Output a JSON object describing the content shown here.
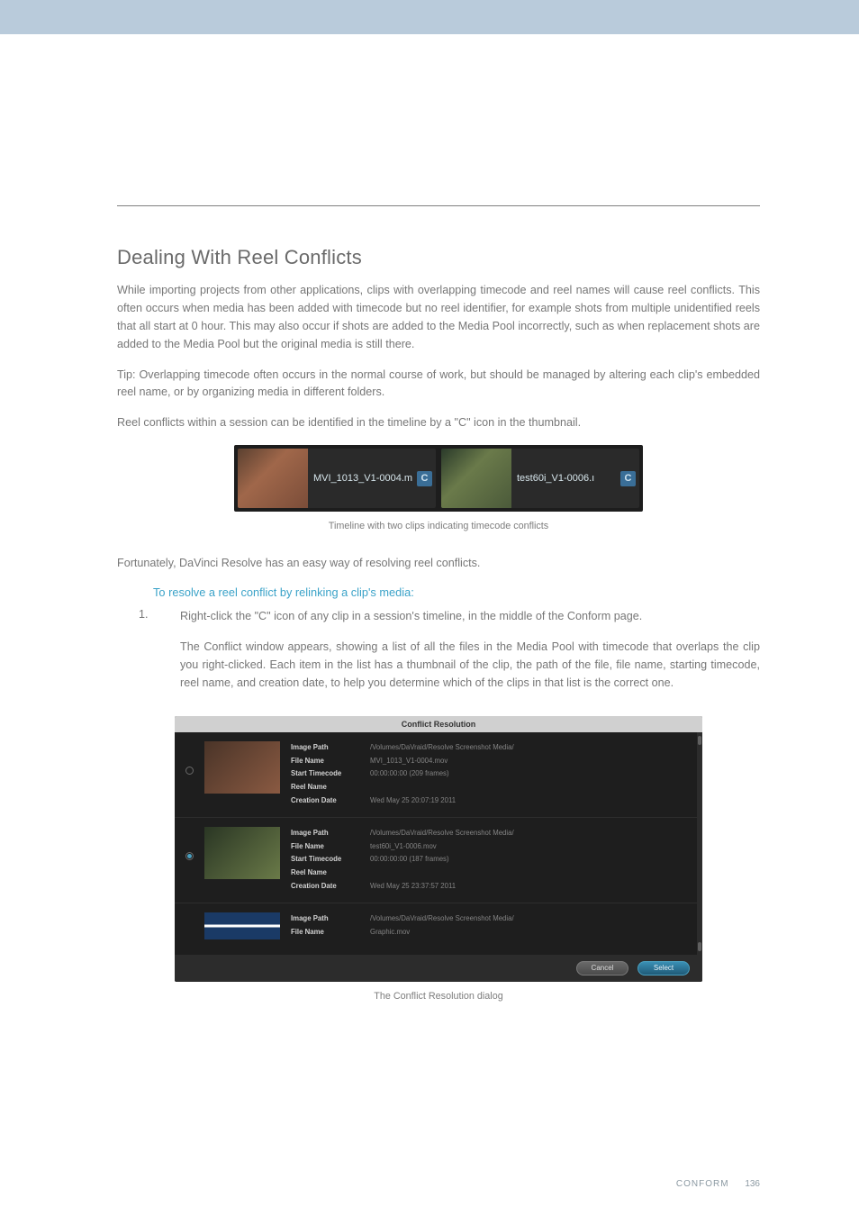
{
  "header": {
    "section_title": "Dealing With Reel Conflicts"
  },
  "paragraphs": {
    "p1": "While importing projects from other applications, clips with overlapping timecode and reel names will cause reel conflicts. This often occurs when media has been added with timecode but no reel identifier, for example shots from multiple unidentified reels that all start at 0 hour. This may also occur if shots are added to the Media Pool incorrectly, such as when replacement shots are added to the Media Pool but the original media is still there.",
    "p2": "Tip: Overlapping timecode often occurs in the normal course of work, but should be managed by altering each clip's embedded reel name, or by organizing media in different folders.",
    "p3": "Reel conflicts within a session can be identified in the timeline by a \"C\" icon in the thumbnail.",
    "p4": "Fortunately, DaVinci Resolve has an easy way of resolving reel conflicts."
  },
  "fig1": {
    "clip1_name": "MVI_1013_V1-0004.m",
    "clip2_name": "test60i_V1-0006.ı",
    "c_label": "C",
    "caption": "Timeline with two clips indicating timecode conflicts"
  },
  "procedure": {
    "subhead": "To resolve a reel conflict by relinking a clip's media:",
    "step1_num": "1.",
    "step1_a": "Right-click the \"C\" icon of any clip in a session's timeline, in the middle of the Conform page.",
    "step1_b": "The Conflict window appears, showing a list of all the files in the Media Pool with timecode that overlaps the clip you right-clicked. Each item in the list has a thumbnail of the clip, the path of the file, file name, starting timecode, reel name, and creation date, to help you determine which of the clips in that list is the correct one."
  },
  "fig2": {
    "title": "Conflict Resolution",
    "labels": {
      "image_path": "Image Path",
      "file_name": "File Name",
      "start_tc": "Start Timecode",
      "reel_name": "Reel Name",
      "creation": "Creation Date"
    },
    "entries": [
      {
        "image_path": "/Volumes/DaVraid/Resolve Screenshot Media/",
        "file_name": "MVI_1013_V1-0004.mov",
        "start_tc": "00:00:00:00 (209 frames)",
        "reel_name": "",
        "creation": "Wed May 25 20:07:19 2011"
      },
      {
        "image_path": "/Volumes/DaVraid/Resolve Screenshot Media/",
        "file_name": "test60i_V1-0006.mov",
        "start_tc": "00:00:00:00 (187 frames)",
        "reel_name": "",
        "creation": "Wed May 25 23:37:57 2011"
      },
      {
        "image_path": "/Volumes/DaVraid/Resolve Screenshot Media/",
        "file_name": "Graphic.mov"
      }
    ],
    "buttons": {
      "cancel": "Cancel",
      "select": "Select"
    },
    "caption": "The Conflict Resolution dialog"
  },
  "footer": {
    "section": "CONFORM",
    "page": "136"
  }
}
